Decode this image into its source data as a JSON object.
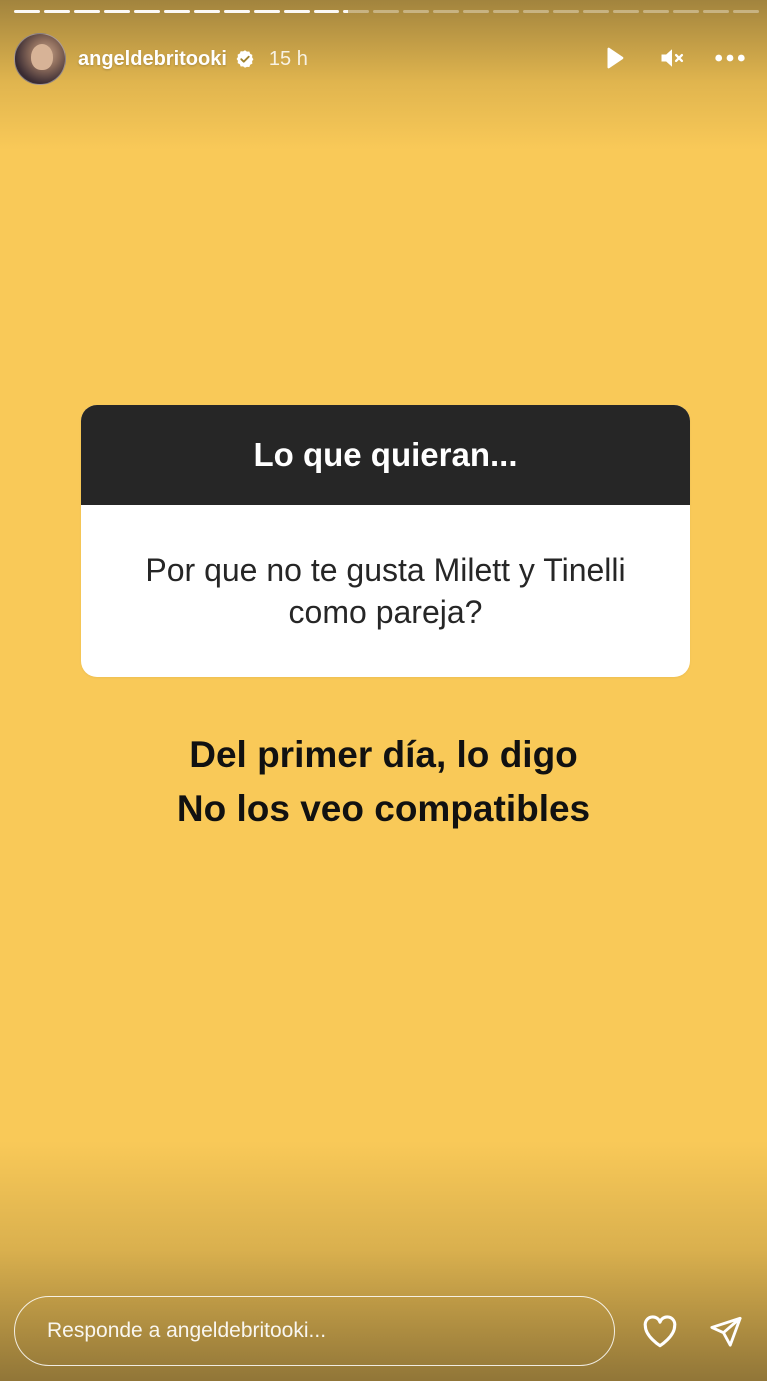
{
  "story": {
    "segments_total": 25,
    "segments_done": 11,
    "current_segment_progress": 0.2
  },
  "header": {
    "username": "angeldebritooki",
    "time": "15 h",
    "icons": [
      "play-icon",
      "muted-icon",
      "more-icon"
    ]
  },
  "question": {
    "prompt": "Lo que quieran...",
    "text": "Por que no te gusta Milett y Tinelli como pareja?"
  },
  "answer": {
    "line1": "Del primer día, lo digo",
    "line2": "No los veo compatibles"
  },
  "reply": {
    "placeholder": "Responde a angeldebritooki..."
  },
  "colors": {
    "background": "#f9c958",
    "prompt_bg": "#262626"
  }
}
